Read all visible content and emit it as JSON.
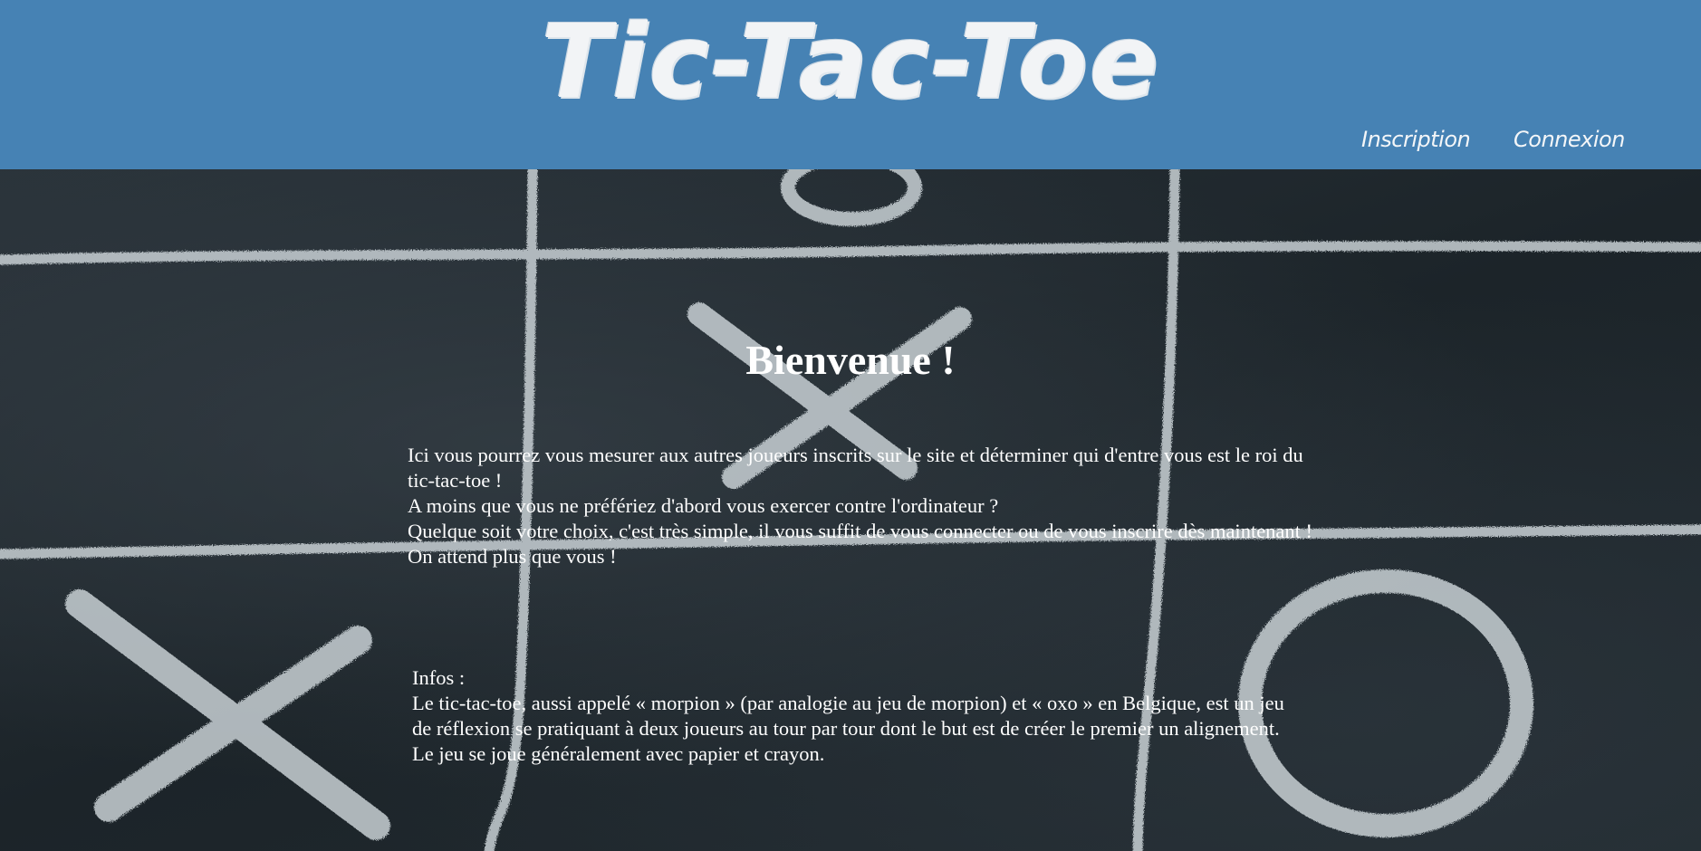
{
  "header": {
    "logo": "Tic-Tac-Toe",
    "nav": {
      "inscription": "Inscription",
      "connexion": "Connexion"
    },
    "background_color": "#4682b4"
  },
  "main": {
    "title": "Bienvenue !",
    "intro_lines": [
      "Ici vous pourrez vous mesurer aux autres joueurs inscrits sur le site et déterminer qui d'entre vous est le roi du tic-tac-toe !",
      "A moins que vous ne préfériez d'abord vous exercer contre l'ordinateur ?",
      "Quelque soit votre choix, c'est très simple, il vous suffit de vous connecter ou de vous inscrire dès maintenant !",
      "On attend plus que vous !"
    ],
    "infos": {
      "heading": "Infos :",
      "text": "Le tic-tac-toe, aussi appelé « morpion » (par analogie au jeu de morpion) et « oxo » en Belgique, est un jeu de réflexion se pratiquant à deux joueurs au tour par tour dont le but est de créer le premier un alignement. Le jeu se joue généralement avec papier et crayon."
    }
  },
  "background": {
    "image": "chalkboard-tic-tac-toe-grid",
    "chalk_color": "#c8d0d4"
  }
}
